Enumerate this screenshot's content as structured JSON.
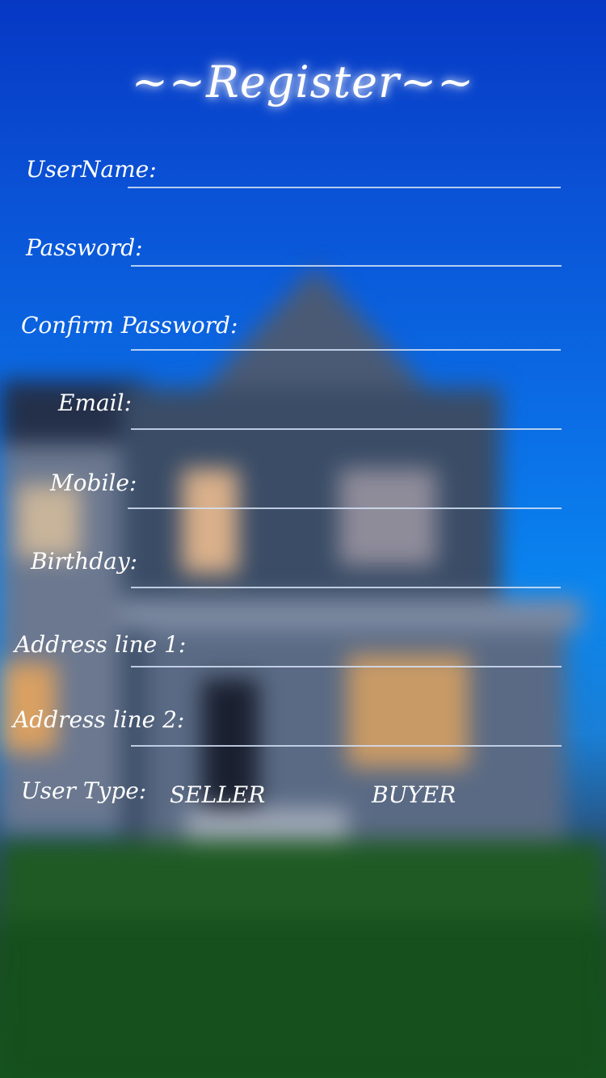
{
  "title": "~~Register~~",
  "fields": [
    {
      "id": "username",
      "label": "UserName:",
      "value": ""
    },
    {
      "id": "password",
      "label": "Password:",
      "value": ""
    },
    {
      "id": "confirm_password",
      "label": "Confirm Password:",
      "value": ""
    },
    {
      "id": "email",
      "label": "Email:",
      "value": ""
    },
    {
      "id": "mobile",
      "label": "Mobile:",
      "value": ""
    },
    {
      "id": "birthday",
      "label": "Birthday:",
      "value": ""
    },
    {
      "id": "address_line_1",
      "label": "Address line 1:",
      "value": ""
    },
    {
      "id": "address_line_2",
      "label": "Address line 2:",
      "value": ""
    }
  ],
  "user_type": {
    "label": "User Type:",
    "options": [
      "SELLER",
      "BUYER"
    ]
  }
}
